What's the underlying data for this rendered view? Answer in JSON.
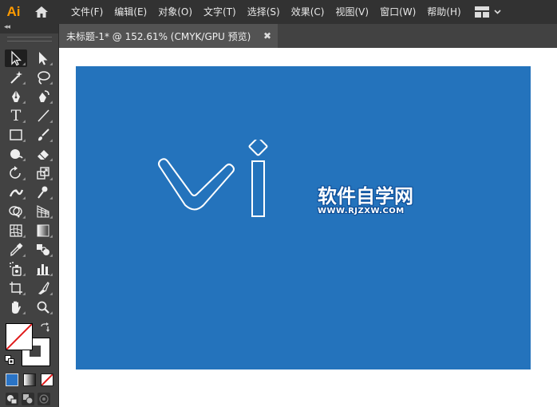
{
  "app": {
    "logo": "Ai"
  },
  "menu": {
    "items": [
      "文件(F)",
      "编辑(E)",
      "对象(O)",
      "文字(T)",
      "选择(S)",
      "效果(C)",
      "视图(V)",
      "窗口(W)",
      "帮助(H)"
    ]
  },
  "toolbar": {
    "collapse_label": "◂◂"
  },
  "tab": {
    "title": "未标题-1* @ 152.61% (CMYK/GPU 预览)",
    "close": "✖"
  },
  "artwork": {
    "watermark_title": "软件自学网",
    "watermark_url": "WWW.RJZXW.COM"
  },
  "colors": {
    "menubar": "#323232",
    "panel": "#424242",
    "workspace": "#535353",
    "artboard": "#2473bc",
    "logo_orange": "#ff9a00"
  }
}
